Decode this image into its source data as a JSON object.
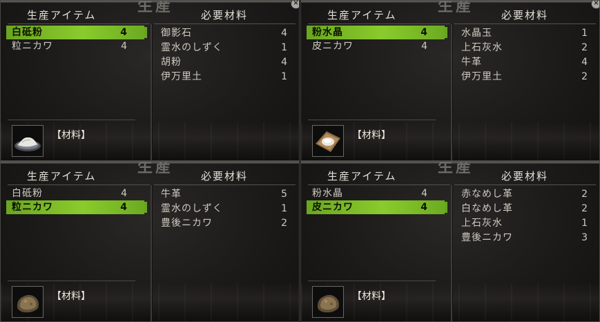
{
  "panels": [
    {
      "header_left": "生産アイテム",
      "header_right": "必要材料",
      "watermark": "生産",
      "items": [
        {
          "name": "白砥粉",
          "qty": "4",
          "selected": true
        },
        {
          "name": "粒ニカワ",
          "qty": "4",
          "selected": false
        }
      ],
      "materials": [
        {
          "name": "御影石",
          "qty": "4"
        },
        {
          "name": "霊水のしずく",
          "qty": "1"
        },
        {
          "name": "胡粉",
          "qty": "4"
        },
        {
          "name": "伊万里土",
          "qty": "1"
        }
      ],
      "material_label": "【材料】",
      "thumb_icon": "white-powder-plate-icon"
    },
    {
      "header_left": "生産アイテム",
      "header_right": "必要材料",
      "watermark": "生産",
      "items": [
        {
          "name": "粉水晶",
          "qty": "4",
          "selected": true
        },
        {
          "name": "皮ニカワ",
          "qty": "4",
          "selected": false
        }
      ],
      "materials": [
        {
          "name": "水晶玉",
          "qty": "1"
        },
        {
          "name": "上石灰水",
          "qty": "2"
        },
        {
          "name": "牛革",
          "qty": "4"
        },
        {
          "name": "伊万里土",
          "qty": "2"
        }
      ],
      "material_label": "【材料】",
      "thumb_icon": "crystal-powder-cloth-icon"
    },
    {
      "header_left": "生産アイテム",
      "header_right": "必要材料",
      "watermark": "生産",
      "items": [
        {
          "name": "白砥粉",
          "qty": "4",
          "selected": false
        },
        {
          "name": "粒ニカワ",
          "qty": "4",
          "selected": true
        }
      ],
      "materials": [
        {
          "name": "牛革",
          "qty": "5"
        },
        {
          "name": "霊水のしずく",
          "qty": "1"
        },
        {
          "name": "豊後ニカワ",
          "qty": "2"
        }
      ],
      "material_label": "【材料】",
      "thumb_icon": "glue-lump-icon"
    },
    {
      "header_left": "生産アイテム",
      "header_right": "必要材料",
      "watermark": "生産",
      "items": [
        {
          "name": "粉水晶",
          "qty": "4",
          "selected": false
        },
        {
          "name": "皮ニカワ",
          "qty": "4",
          "selected": true
        }
      ],
      "materials": [
        {
          "name": "赤なめし革",
          "qty": "2"
        },
        {
          "name": "白なめし革",
          "qty": "2"
        },
        {
          "name": "上石灰水",
          "qty": "1"
        },
        {
          "name": "豊後ニカワ",
          "qty": "3"
        }
      ],
      "material_label": "【材料】",
      "thumb_icon": "glue-lump-icon"
    }
  ],
  "close_glyph": "×",
  "colors": {
    "selection": "#7cbc27",
    "text": "#cfcbc2",
    "background": "#1b1a19"
  }
}
